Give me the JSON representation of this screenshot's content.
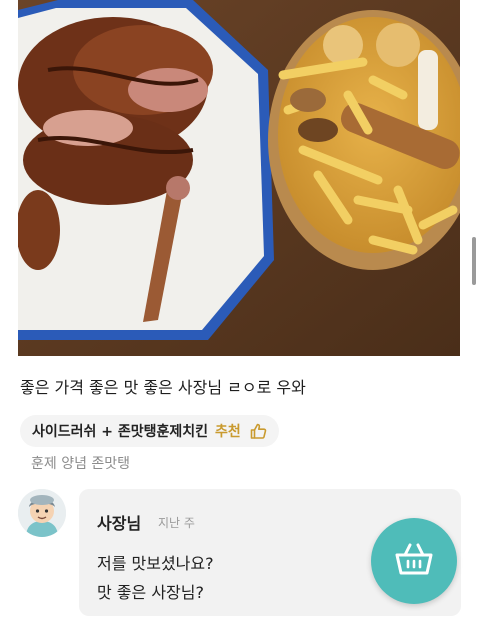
{
  "review": {
    "photo_alt": "",
    "text": "좋은 가격 좋은 맛 좋은 사장님 ㄹㅇ로 우와",
    "menu_chip": {
      "menu": "사이드러쉬 + 존맛탱훈제치킨",
      "recommend_label": "추천",
      "recommend_icon": "thumbs-up-icon"
    },
    "option": "훈제 양념 존맛탱"
  },
  "owner_reply": {
    "avatar_icon": "owner-avatar",
    "name": "사장님",
    "time": "지난 주",
    "line1": "저를 맛보셨나요?",
    "line2": "맛 좋은 사장님?"
  },
  "cart": {
    "icon": "basket-icon",
    "color": "#4fbcb9"
  },
  "colors": {
    "recommend": "#c99a2e",
    "muted": "#8c8c8c"
  }
}
